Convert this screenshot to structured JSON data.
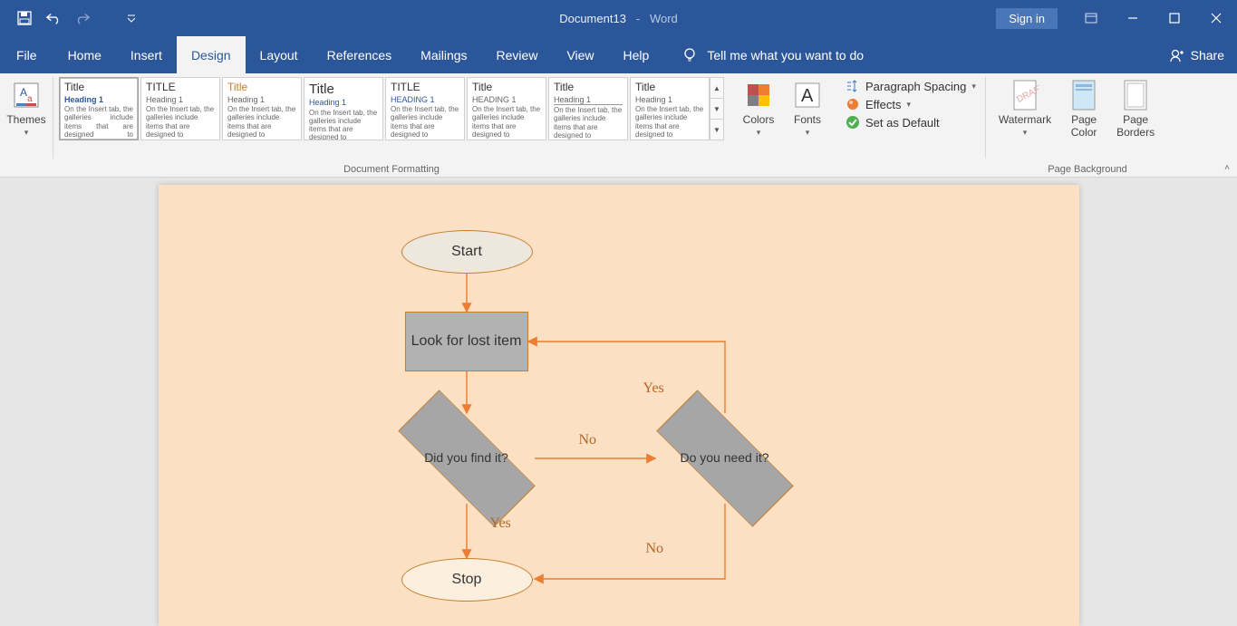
{
  "title": {
    "doc": "Document13",
    "app": "Word"
  },
  "qat": {
    "save": "save",
    "undo": "undo",
    "redo": "redo"
  },
  "signin": "Sign in",
  "tabs": [
    "File",
    "Home",
    "Insert",
    "Design",
    "Layout",
    "References",
    "Mailings",
    "Review",
    "View",
    "Help"
  ],
  "active_tab": "Design",
  "tell_me": "Tell me what you want to do",
  "share": "Share",
  "ribbon": {
    "themes": "Themes",
    "gallery_items": [
      {
        "title": "Title",
        "heading": "Heading 1",
        "title_color": "#333",
        "h_color": "#2b579a"
      },
      {
        "title": "TITLE",
        "heading": "Heading 1",
        "title_color": "#333",
        "h_color": "#333"
      },
      {
        "title": "Title",
        "heading": "Heading 1",
        "title_color": "#c97c2b",
        "h_color": "#333"
      },
      {
        "title": "Title",
        "heading": "Heading 1",
        "title_color": "#333",
        "h_color": "#2b579a"
      },
      {
        "title": "TITLE",
        "heading": "HEADING 1",
        "title_color": "#333",
        "h_color": "#2b579a"
      },
      {
        "title": "Title",
        "heading": "HEADING 1",
        "title_color": "#333",
        "h_color": "#333"
      },
      {
        "title": "Title",
        "heading": "Heading 1",
        "title_color": "#333",
        "h_color": "#555"
      },
      {
        "title": "Title",
        "heading": "Heading 1",
        "title_color": "#333",
        "h_color": "#333"
      }
    ],
    "filler": "On the Insert tab, the galleries include items that are designed to coordinate with the overall look of your document. You can use these galleries to insert tables, headers, footers, lists, cover pages, and other",
    "doc_formatting_label": "Document Formatting",
    "colors": "Colors",
    "fonts": "Fonts",
    "paragraph_spacing": "Paragraph Spacing",
    "effects": "Effects",
    "set_default": "Set as Default",
    "watermark": "Watermark",
    "page_color": "Page\nColor",
    "page_borders": "Page\nBorders",
    "page_bg_label": "Page Background"
  },
  "flowchart": {
    "start": "Start",
    "look": "Look for lost item",
    "find": "Did you find it?",
    "need": "Do you need it?",
    "stop": "Stop",
    "yes1": "Yes",
    "no1": "No",
    "yes2": "Yes",
    "no2": "No",
    "colors": {
      "page_bg": "#fbe0c3",
      "shape_border": "#c97c2b",
      "arrow": "#ed7d31",
      "label": "#b4652a"
    }
  }
}
